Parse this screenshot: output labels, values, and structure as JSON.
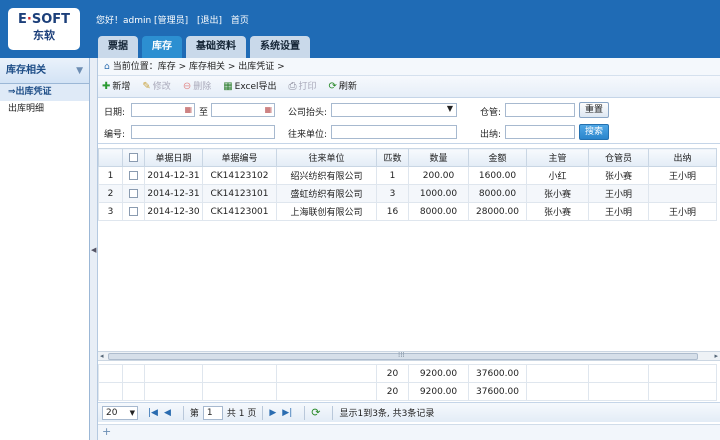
{
  "logo": {
    "line1_a": "E",
    "line1_dot": "·",
    "line1_b": "SOFT",
    "line2": "东软"
  },
  "userbar": {
    "greeting": "您好！admin [管理员]",
    "logout": "[退出]",
    "home": "首页"
  },
  "tabs": [
    {
      "label": "票据",
      "active": false
    },
    {
      "label": "库存",
      "active": true
    },
    {
      "label": "基础资料",
      "active": false
    },
    {
      "label": "系统设置",
      "active": false
    }
  ],
  "sidebar": {
    "title": "库存相关",
    "items": [
      {
        "label": "⇒出库凭证",
        "active": true
      },
      {
        "label": "出库明细",
        "active": false
      }
    ]
  },
  "breadcrumb": "当前位置：库存 > 库存相关 > 出库凭证 >",
  "toolbar": {
    "add": "新增",
    "edit": "修改",
    "delete": "删除",
    "excel": "Excel导出",
    "print": "打印",
    "refresh": "刷新"
  },
  "filter": {
    "date_label": "日期:",
    "to_label": "至",
    "company_label": "公司抬头:",
    "warehouse_label": "仓管:",
    "reset": "重置",
    "code_label": "编号:",
    "partner_label": "往来单位:",
    "cashier_label": "出纳:",
    "search": "搜索"
  },
  "table": {
    "headers": [
      "",
      "",
      "单据日期",
      "单据编号",
      "往来单位",
      "匹数",
      "数量",
      "金额",
      "主管",
      "仓管员",
      "出纳"
    ],
    "rows": [
      [
        "1",
        "",
        "2014-12-31",
        "CK14123102",
        "绍兴纺织有限公司",
        "1",
        "200.00",
        "1600.00",
        "小红",
        "张小赛",
        "王小明"
      ],
      [
        "2",
        "",
        "2014-12-31",
        "CK14123101",
        "盛虹纺织有限公司",
        "3",
        "1000.00",
        "8000.00",
        "张小赛",
        "王小明",
        ""
      ],
      [
        "3",
        "",
        "2014-12-30",
        "CK14123001",
        "上海联创有限公司",
        "16",
        "8000.00",
        "28000.00",
        "张小赛",
        "王小明",
        "王小明"
      ]
    ],
    "footer_rows": [
      [
        "",
        "",
        "",
        "",
        "",
        "20",
        "9200.00",
        "37600.00",
        "",
        "",
        ""
      ],
      [
        "",
        "",
        "",
        "",
        "",
        "20",
        "9200.00",
        "37600.00",
        "",
        "",
        ""
      ]
    ]
  },
  "pager": {
    "page_size": "20",
    "page_prefix": "第",
    "page": "1",
    "page_total": "共 1 页",
    "summary": "显示1到3条, 共3条记录"
  }
}
